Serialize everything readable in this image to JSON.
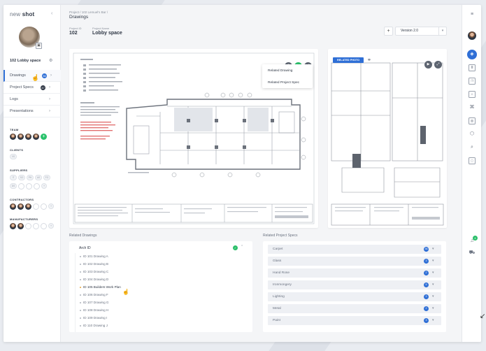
{
  "app": {
    "logo_light": "new ",
    "logo_bold": "shot"
  },
  "sidebar": {
    "project_label": "102 Lobby space",
    "nav": [
      {
        "label": "Drawings",
        "badge": "36",
        "active": true
      },
      {
        "label": "Project Specs",
        "badge": "47",
        "active": false
      },
      {
        "label": "Logs",
        "badge": "",
        "active": false
      },
      {
        "label": "Presentations",
        "badge": "",
        "active": false
      }
    ],
    "sections": {
      "team": "TEAM",
      "clients": "CLIENTS",
      "suppliers": "SUPPLIERS",
      "contractors": "CONTRACTORS",
      "manufacturers": "MANUFACTURERS"
    },
    "client_tags": [
      "VS"
    ],
    "supplier_tags": [
      "IT",
      "SO",
      "PH",
      "AS",
      "FO",
      "DS"
    ]
  },
  "header": {
    "breadcrumb": "Project / 102 Lemuel's Bar /",
    "title": "Drawings",
    "project_id_label": "Project ID",
    "project_id": "102",
    "project_name_label": "Project Name",
    "project_name": "Lobby space",
    "add_label": "+",
    "version": "Version 2.0"
  },
  "drawing_menu": {
    "items": [
      "Related Drawing",
      "Related Project Spec"
    ]
  },
  "right_card": {
    "badge": "RELATED PHOTO"
  },
  "related_drawings": {
    "title": "Related Drawings",
    "folder": "Arch ID",
    "items": [
      "ID 101 Drawing A",
      "ID 102 Drawing B",
      "ID 103 Drawing C",
      "ID 104 Drawing D",
      "ID 105 Builders Work Plan",
      "ID 106 Drawing F",
      "ID 107 Drawing G",
      "ID 108 Drawing H",
      "ID 109 Drawing I",
      "ID 110 Drawing J"
    ],
    "highlight_index": 4
  },
  "related_specs": {
    "title": "Related Project Specs",
    "items": [
      {
        "label": "Carpet",
        "count": "36"
      },
      {
        "label": "Glass",
        "count": "3"
      },
      {
        "label": "Hand Rose",
        "count": "2"
      },
      {
        "label": "Ironmongery",
        "count": "5"
      },
      {
        "label": "Lighting",
        "count": "3"
      },
      {
        "label": "Metal",
        "count": "2"
      },
      {
        "label": "Paint",
        "count": "3"
      }
    ]
  },
  "rail": {
    "notification_count": "4"
  },
  "colors": {
    "accent": "#2f6fd6",
    "green": "#2bbf6a",
    "dark": "#2f3745"
  }
}
